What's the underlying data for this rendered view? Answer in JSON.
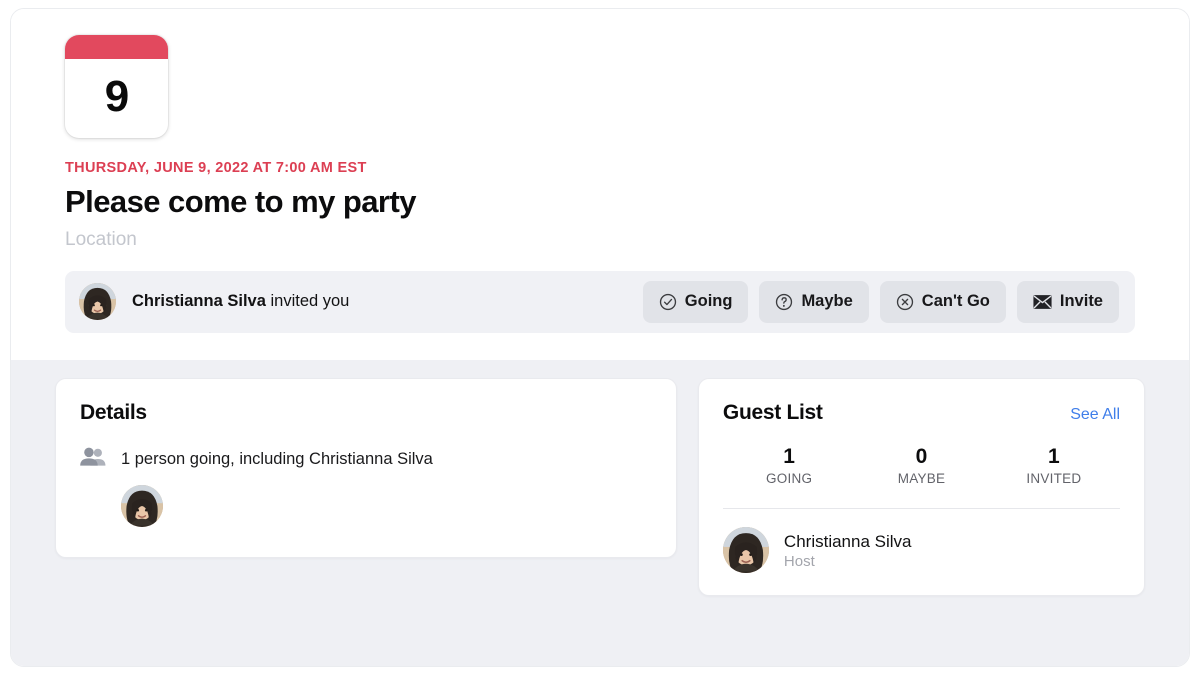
{
  "event": {
    "calendar_day": "9",
    "date_line": "THURSDAY, JUNE 9, 2022 AT 7:00 AM EST",
    "title": "Please come to my party",
    "location_placeholder": "Location",
    "accent_color": "#dc3f53",
    "calendar_band_color": "#e2495e"
  },
  "invite_bar": {
    "host_name": "Christianna Silva",
    "invited_text": " invited you",
    "avatar_alt": "Christianna Silva",
    "buttons": [
      {
        "label": "Going",
        "icon": "check-circle-icon"
      },
      {
        "label": "Maybe",
        "icon": "question-circle-icon"
      },
      {
        "label": "Can't Go",
        "icon": "x-circle-icon"
      },
      {
        "label": "Invite",
        "icon": "envelope-icon"
      }
    ]
  },
  "details": {
    "title": "Details",
    "going_icon": "people-icon",
    "going_summary": "1 person going, including Christianna Silva",
    "attendee_avatars": [
      {
        "alt": "Christianna Silva"
      }
    ]
  },
  "guest_list": {
    "title": "Guest List",
    "see_all_label": "See All",
    "see_all_color": "#3f7eea",
    "counts": [
      {
        "value": "1",
        "label": "GOING"
      },
      {
        "value": "0",
        "label": "MAYBE"
      },
      {
        "value": "1",
        "label": "INVITED"
      }
    ],
    "guests": [
      {
        "name": "Christianna Silva",
        "role": "Host",
        "avatar_alt": "Christianna Silva"
      }
    ]
  }
}
